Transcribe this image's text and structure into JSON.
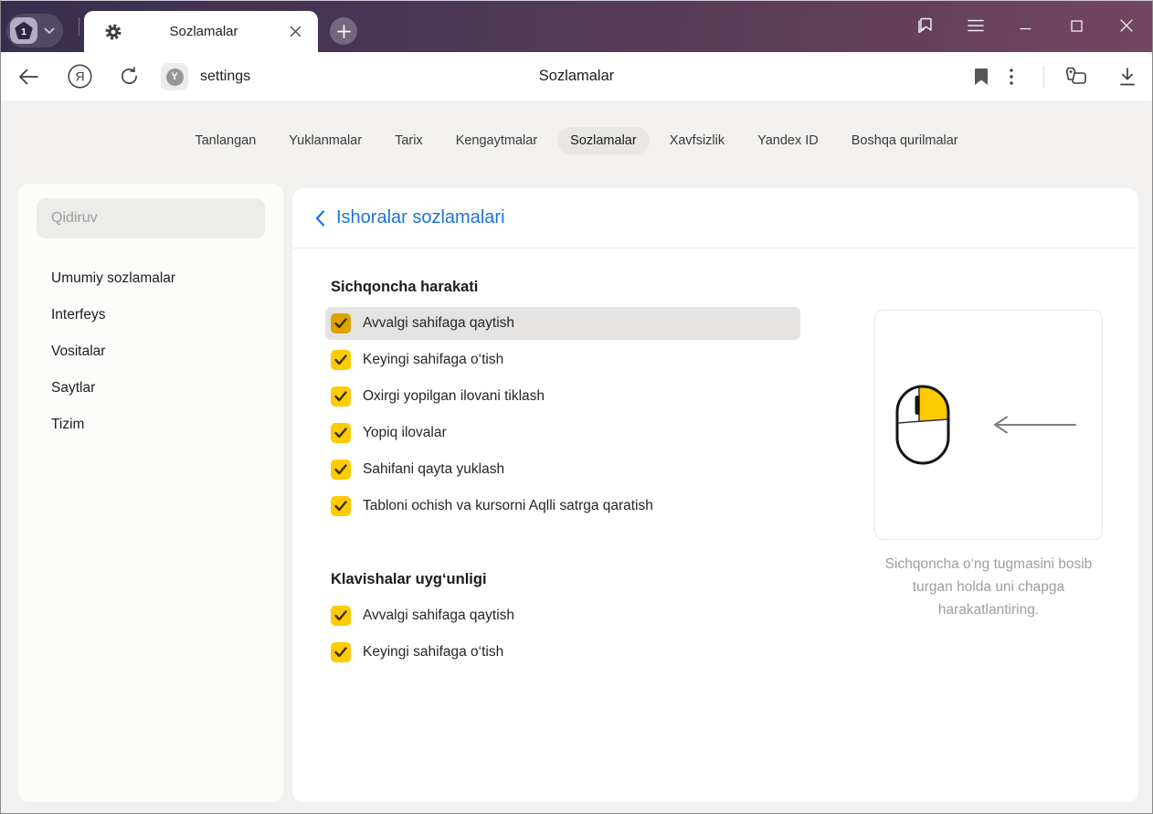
{
  "titlebar": {
    "tab_group_count": "1",
    "tab_title": "Sozlamalar"
  },
  "toolbar": {
    "address_text": "settings",
    "page_title": "Sozlamalar"
  },
  "nav": {
    "active_tab": "Sozlamalar",
    "tabs": [
      {
        "label": "Tanlangan"
      },
      {
        "label": "Yuklanmalar"
      },
      {
        "label": "Tarix"
      },
      {
        "label": "Kengaytmalar"
      },
      {
        "label": "Sozlamalar"
      },
      {
        "label": "Xavfsizlik"
      },
      {
        "label": "Yandex ID"
      },
      {
        "label": "Boshqa qurilmalar"
      }
    ]
  },
  "sidebar": {
    "search_placeholder": "Qidiruv",
    "items": [
      {
        "label": "Umumiy sozlamalar"
      },
      {
        "label": "Interfeys"
      },
      {
        "label": "Vositalar"
      },
      {
        "label": "Saytlar"
      },
      {
        "label": "Tizim"
      }
    ]
  },
  "main": {
    "back_label": "Ishoralar sozlamalari",
    "sections": [
      {
        "title": "Sichqoncha harakati",
        "items": [
          {
            "label": "Avvalgi sahifaga qaytish",
            "checked": true,
            "highlighted": true
          },
          {
            "label": "Keyingi sahifaga o‘tish",
            "checked": true,
            "highlighted": false
          },
          {
            "label": "Oxirgi yopilgan ilovani tiklash",
            "checked": true,
            "highlighted": false
          },
          {
            "label": "Yopiq ilovalar",
            "checked": true,
            "highlighted": false
          },
          {
            "label": "Sahifani qayta yuklash",
            "checked": true,
            "highlighted": false
          },
          {
            "label": "Tabloni ochish va kursorni Aqlli satrga qaratish",
            "checked": true,
            "highlighted": false
          }
        ]
      },
      {
        "title": "Klavishalar uyg‘unligi",
        "items": [
          {
            "label": "Avvalgi sahifaga qaytish",
            "checked": true,
            "highlighted": false
          },
          {
            "label": "Keyingi sahifaga o‘tish",
            "checked": true,
            "highlighted": false
          }
        ]
      }
    ],
    "illustration_caption": "Sichqoncha o‘ng tugmasini bosib turgan holda uni chapga harakatlantiring."
  },
  "colors": {
    "accent_yellow": "#fdcb00",
    "accent_yellow_pressed": "#dfa300",
    "link_blue": "#1f72d6",
    "titlebar_gradient_start": "#372e4d",
    "titlebar_gradient_end": "#74465f",
    "row_highlight": "#e4e3e2"
  }
}
